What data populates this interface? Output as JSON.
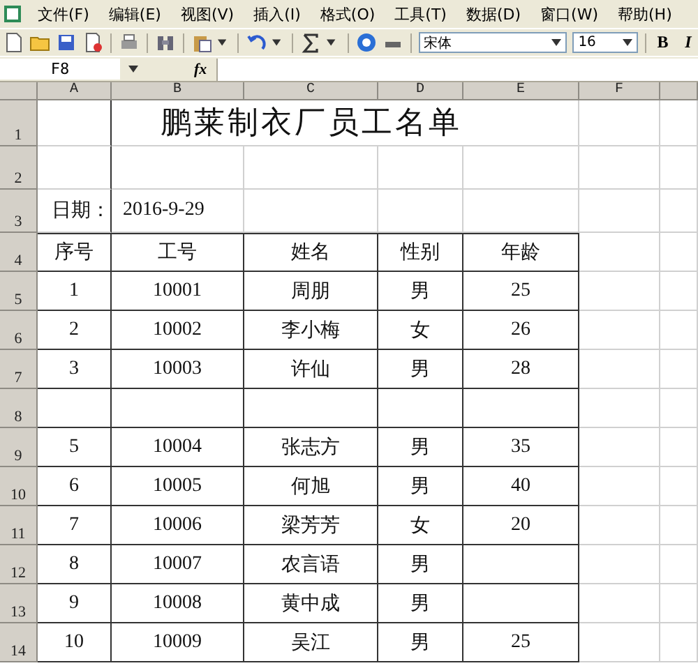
{
  "menu": [
    "文件(F)",
    "编辑(E)",
    "视图(V)",
    "插入(I)",
    "格式(O)",
    "工具(T)",
    "数据(D)",
    "窗口(W)",
    "帮助(H)"
  ],
  "toolbar": {
    "font_name": "宋体",
    "font_size": "16",
    "bold": "B",
    "italic": "I"
  },
  "formula_bar": {
    "name_box": "F8",
    "fx": "fx"
  },
  "columns": [
    "A",
    "B",
    "C",
    "D",
    "E",
    "F"
  ],
  "rows": [
    {
      "number": "1",
      "kind": "title",
      "title": "鹏莱制衣厂员工名单"
    },
    {
      "number": "2",
      "kind": "plain",
      "cells": [
        "",
        "",
        "",
        "",
        "",
        ""
      ]
    },
    {
      "number": "3",
      "kind": "plain",
      "cells": [
        "日期：",
        "2016-9-29",
        "",
        "",
        "",
        ""
      ]
    },
    {
      "number": "4",
      "kind": "table",
      "cells": [
        "序号",
        "工号",
        "姓名",
        "性别",
        "年龄",
        ""
      ]
    },
    {
      "number": "5",
      "kind": "table",
      "cells": [
        "1",
        "10001",
        "周朋",
        "男",
        "25",
        ""
      ]
    },
    {
      "number": "6",
      "kind": "table",
      "cells": [
        "2",
        "10002",
        "李小梅",
        "女",
        "26",
        ""
      ]
    },
    {
      "number": "7",
      "kind": "table",
      "cells": [
        "3",
        "10003",
        "许仙",
        "男",
        "28",
        ""
      ]
    },
    {
      "number": "8",
      "kind": "table",
      "cells": [
        "",
        "",
        "",
        "",
        "",
        ""
      ]
    },
    {
      "number": "9",
      "kind": "table",
      "cells": [
        "5",
        "10004",
        "张志方",
        "男",
        "35",
        ""
      ]
    },
    {
      "number": "10",
      "kind": "table",
      "cells": [
        "6",
        "10005",
        "何旭",
        "男",
        "40",
        ""
      ]
    },
    {
      "number": "11",
      "kind": "table",
      "cells": [
        "7",
        "10006",
        "梁芳芳",
        "女",
        "20",
        ""
      ]
    },
    {
      "number": "12",
      "kind": "table",
      "cells": [
        "8",
        "10007",
        "农言语",
        "男",
        "",
        ""
      ]
    },
    {
      "number": "13",
      "kind": "table",
      "cells": [
        "9",
        "10008",
        "黄中成",
        "男",
        "",
        ""
      ]
    },
    {
      "number": "14",
      "kind": "table",
      "cells": [
        "10",
        "10009",
        "吴江",
        "男",
        "25",
        ""
      ]
    }
  ]
}
